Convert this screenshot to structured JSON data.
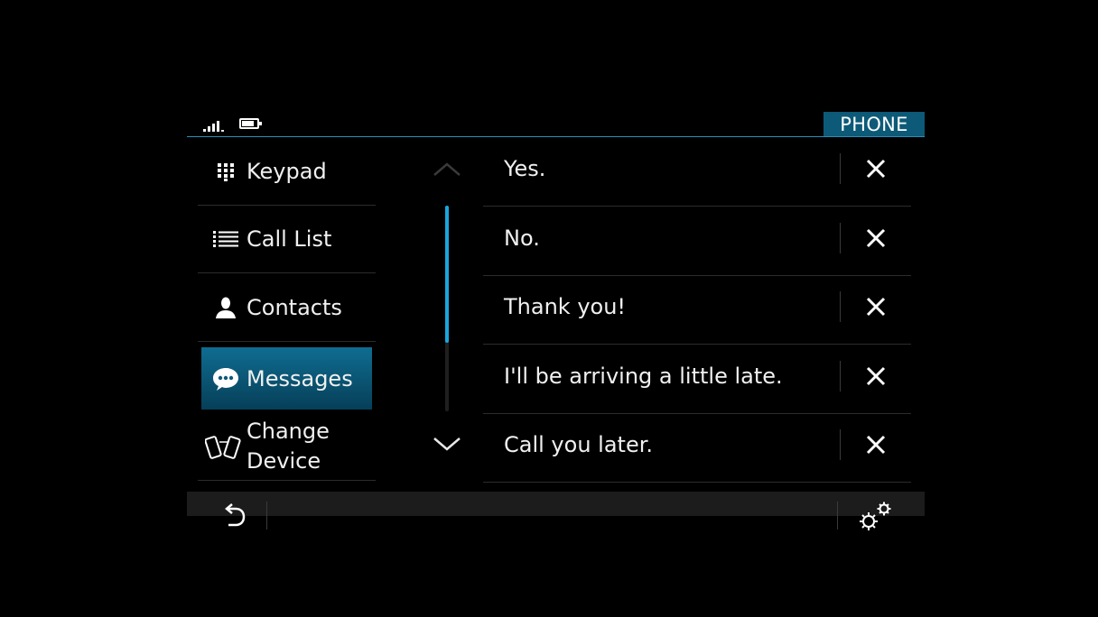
{
  "header": {
    "title": "PHONE"
  },
  "status": {
    "signal_icon": "signal-bars-icon",
    "battery_icon": "battery-icon"
  },
  "menu": {
    "items": [
      {
        "label": "Keypad",
        "icon": "keypad-icon"
      },
      {
        "label": "Call List",
        "icon": "list-icon"
      },
      {
        "label": "Contacts",
        "icon": "person-icon"
      },
      {
        "label": "Messages",
        "icon": "chat-bubble-icon",
        "active": true
      },
      {
        "label_line1": "Change",
        "label_line2": "Device",
        "icon": "devices-icon"
      }
    ]
  },
  "messages": [
    {
      "text": "Yes."
    },
    {
      "text": "No."
    },
    {
      "text": "Thank you!"
    },
    {
      "text": "I'll be arriving a little late."
    },
    {
      "text": "Call you later."
    }
  ],
  "scroll": {
    "position_fraction": 0.0,
    "visible_fraction": 0.67
  },
  "colors": {
    "accent": "#19a6dc",
    "active_item": "#0c5a78",
    "background": "#000000"
  }
}
